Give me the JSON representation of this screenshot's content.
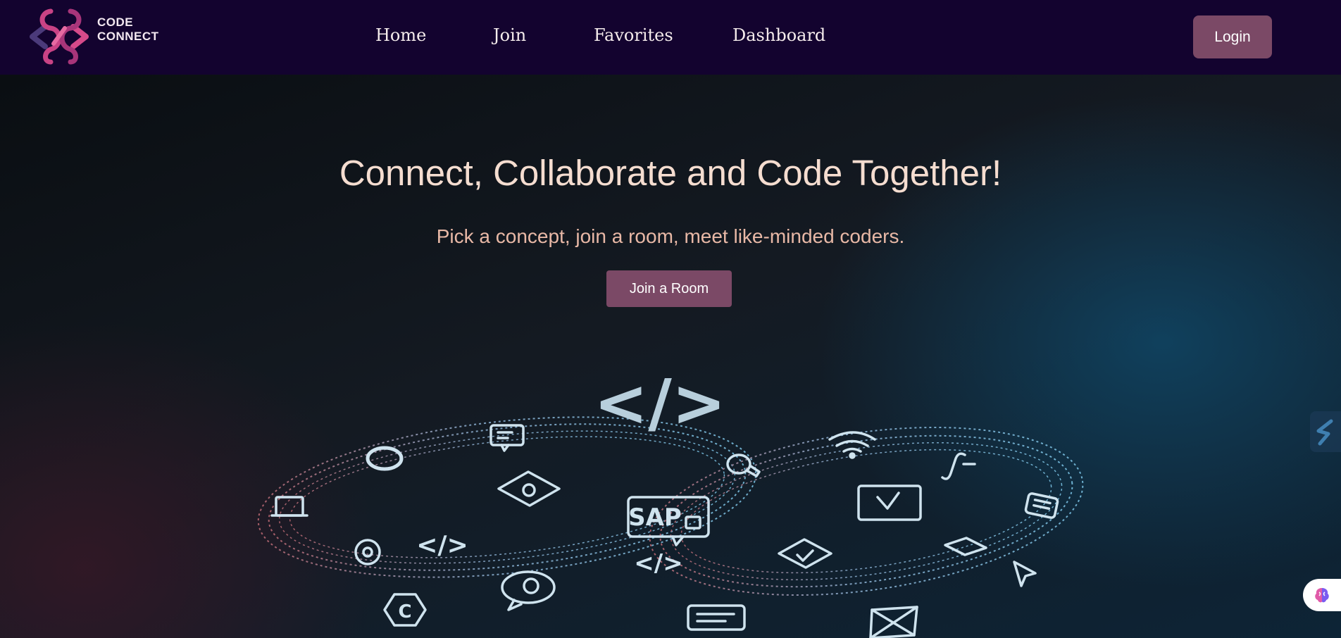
{
  "brand": {
    "line1": "CODE",
    "line2": "CONNECT"
  },
  "nav": {
    "items": [
      {
        "label": "Home"
      },
      {
        "label": "Join"
      },
      {
        "label": "Favorites"
      },
      {
        "label": "Dashboard"
      }
    ],
    "login_label": "Login"
  },
  "hero": {
    "title": "Connect, Collaborate and Code Together!",
    "subtitle": "Pick a concept, join a room, meet like-minded coders.",
    "cta_label": "Join a Room"
  },
  "illustration": {
    "big_tag": "</>",
    "small_tag": "</>",
    "sap_label": "SAP",
    "letter_c": "C",
    "icons": [
      "code-icon",
      "chat-icon",
      "wifi-icon",
      "lightbulb-icon",
      "checkbox-icon",
      "laptop-icon",
      "gear-icon",
      "database-icon",
      "calculator-icon",
      "hexagon-c-icon",
      "cursor-icon"
    ]
  },
  "colors": {
    "navbar": "#13032f",
    "accent": "#7b4966",
    "title": "#f5ddd0",
    "subtitle": "#e8b8a6"
  }
}
